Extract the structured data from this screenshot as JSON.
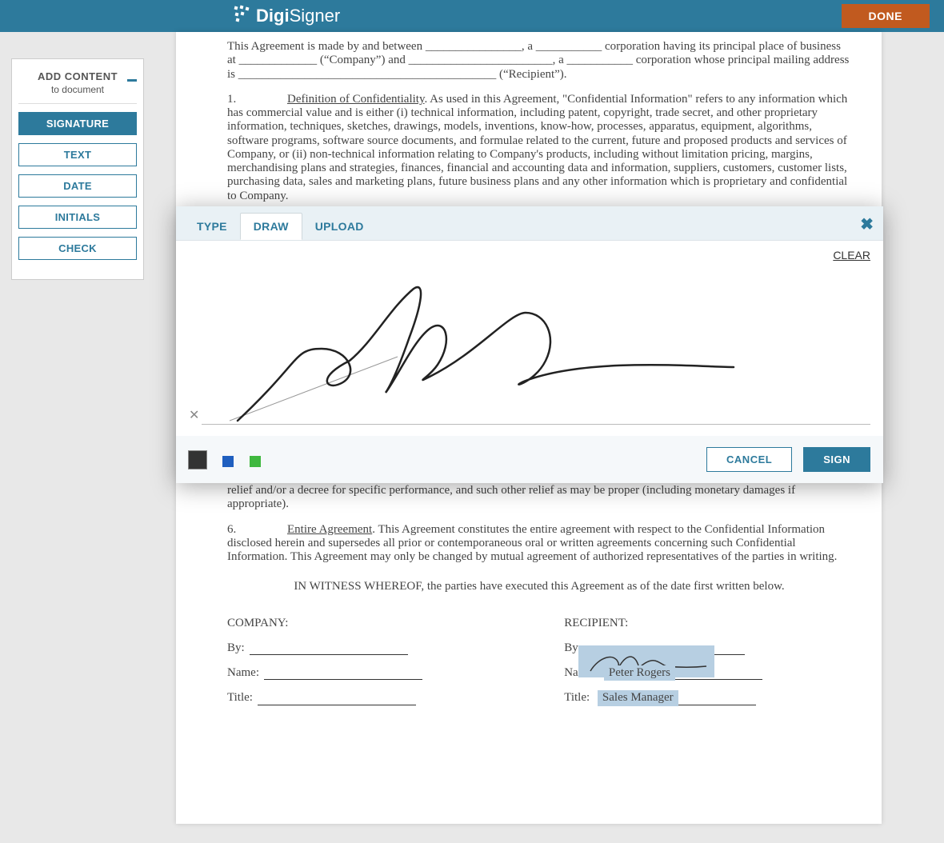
{
  "header": {
    "brand_bold": "Digi",
    "brand_light": "Signer",
    "done_label": "DONE"
  },
  "sidebar": {
    "title": "ADD CONTENT",
    "subtitle": "to document",
    "items": [
      {
        "label": "SIGNATURE",
        "active": true
      },
      {
        "label": "TEXT",
        "active": false
      },
      {
        "label": "DATE",
        "active": false
      },
      {
        "label": "INITIALS",
        "active": false
      },
      {
        "label": "CHECK",
        "active": false
      }
    ]
  },
  "document": {
    "intro": "This Agreement is made by and between ________________, a ___________ corporation having its principal place of business at _____________ (“Company”) and ________________________, a ___________ corporation whose principal mailing address is ___________________________________________ (“Recipient”).",
    "sec1_num": "1.",
    "sec1_title": "Definition of Confidentiality",
    "sec1_body": ". As used in this Agreement, \"Confidential Information\" refers to any information which has commercial value and is either (i) technical information, including patent, copyright, trade secret, and other proprietary information, techniques, sketches, drawings, models, inventions, know-how, processes, apparatus, equipment, algorithms, software programs, software source documents, and formulae related to the current, future and proposed products and services of Company, or (ii) non-technical information relating to Company's products, including without limitation pricing, margins, merchandising plans and strategies, finances, financial and accounting data and information, suppliers, customers, customer lists, purchasing data, sales and marketing plans, future business plans and any other information which is proprietary and confidential to Company.",
    "sec5_tail": "continuing damage to Company for which there will be no adequate remedy at law, and Company shall be entitled to injunctive relief and/or a decree for specific performance, and such other relief as may be proper (including monetary damages if appropriate).",
    "sec6_num": "6.",
    "sec6_title": "Entire Agreement",
    "sec6_body": ".  This Agreement constitutes the entire agreement with respect to the Confidential Information disclosed herein and supersedes all prior or contemporaneous oral or written agreements concerning such Confidential Information.  This Agreement may only be changed by mutual agreement of authorized representatives of the parties in writing.",
    "witness": "IN WITNESS WHEREOF, the parties have executed this Agreement as of the date first written below.",
    "company_label": "COMPANY:",
    "recipient_label": "RECIPIENT:",
    "by_label": "By:",
    "name_label": "Name:",
    "title_label": "Title:",
    "recipient_name": "Peter Rogers",
    "recipient_title": "Sales Manager"
  },
  "modal": {
    "tabs": [
      {
        "label": "TYPE",
        "active": false
      },
      {
        "label": "DRAW",
        "active": true
      },
      {
        "label": "UPLOAD",
        "active": false
      }
    ],
    "clear_label": "CLEAR",
    "cancel_label": "CANCEL",
    "sign_label": "SIGN",
    "colors": [
      {
        "hex": "#333333",
        "selected": true
      },
      {
        "hex": "#1f5fbf",
        "selected": false
      },
      {
        "hex": "#3fb83f",
        "selected": false
      }
    ]
  }
}
